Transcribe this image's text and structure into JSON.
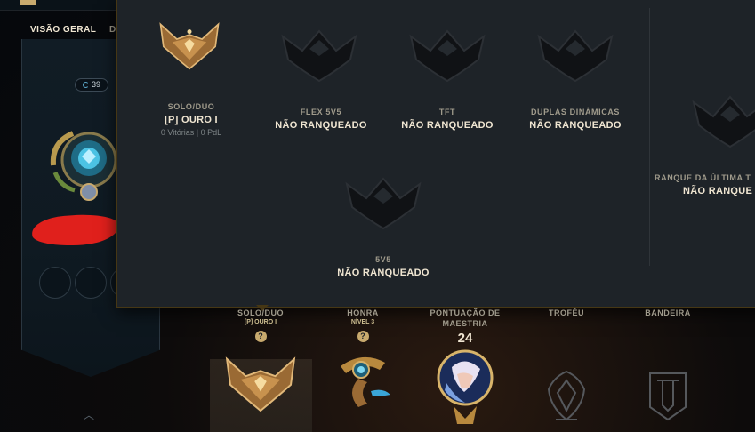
{
  "nav": {
    "tabs": [
      {
        "label": "VISÃO GERAL"
      },
      {
        "label": "D"
      }
    ]
  },
  "profile": {
    "level": "39"
  },
  "ranked_popup": {
    "queues": [
      {
        "queue": "SOLO/DUO",
        "rank": "[P] OURO I",
        "stats": "0 Vitórias | 0 PdL"
      },
      {
        "queue": "FLEX 5V5",
        "rank": "NÃO RANQUEADO"
      },
      {
        "queue": "TFT",
        "rank": "NÃO RANQUEADO"
      },
      {
        "queue": "DUPLAS DINÂMICAS",
        "rank": "NÃO RANQUEADO"
      },
      {
        "queue": "RANQUE DA ÚLTIMA T",
        "rank": "NÃO RANQUE"
      },
      {
        "queue": "5V5",
        "rank": "NÃO RANQUEADO"
      }
    ]
  },
  "showcase": {
    "solo": {
      "label": "SOLO/DUO",
      "sub": "[P] OURO I",
      "help": "?"
    },
    "honor": {
      "label": "HONRA",
      "sub": "NÍVEL 3",
      "help": "?"
    },
    "mastery": {
      "label": "PONTUAÇÃO DE MAESTRIA",
      "value": "24"
    },
    "trophy": {
      "label": "TROFÉU"
    },
    "banner": {
      "label": "BANDEIRA"
    }
  },
  "colors": {
    "gold": "#c8aa6e",
    "panel": "#1e2328",
    "text": "#f0e6d2",
    "muted": "#a09b8c",
    "censor": "#e0201c"
  }
}
